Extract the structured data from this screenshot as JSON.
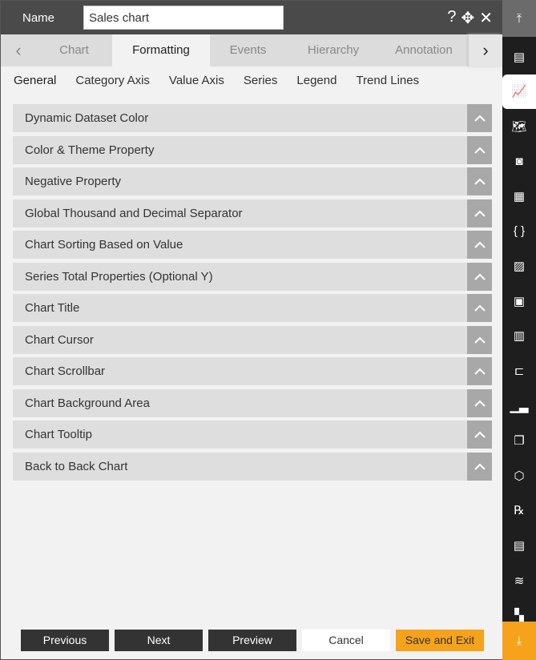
{
  "header": {
    "name_label": "Name",
    "name_value": "Sales chart",
    "help": "?",
    "move": "✥",
    "close": "✕"
  },
  "tabs": [
    "Chart",
    "Formatting",
    "Events",
    "Hierarchy",
    "Annotation"
  ],
  "active_tab": "Formatting",
  "subtabs": [
    "General",
    "Category Axis",
    "Value Axis",
    "Series",
    "Legend",
    "Trend Lines"
  ],
  "sections": [
    "Dynamic Dataset Color",
    "Color & Theme Property",
    "Negative Property",
    "Global Thousand and Decimal Separator",
    "Chart Sorting Based on Value",
    "Series Total Properties (Optional Y)",
    "Chart Title",
    "Chart Cursor",
    "Chart Scrollbar",
    "Chart Background Area",
    "Chart Tooltip",
    "Back to Back Chart"
  ],
  "footer": {
    "previous": "Previous",
    "next": "Next",
    "preview": "Preview",
    "cancel": "Cancel",
    "save": "Save and Exit"
  },
  "sidebar": {
    "icons": [
      "scroll-top-icon",
      "form-icon",
      "chart-icon",
      "map-icon",
      "report-icon",
      "document-icon",
      "code-braces-icon",
      "image-icon",
      "frame-icon",
      "sheet-icon",
      "tree-icon",
      "bar-chart-icon",
      "copy-icon",
      "cubes-icon",
      "rx-icon",
      "file-icon",
      "layers-icon",
      "widgets-icon",
      "scroll-bottom-icon"
    ],
    "active": "chart-icon"
  },
  "colors": {
    "accent": "#f7a21b",
    "header": "#4a4a4a",
    "sidebar": "#1e1e1e"
  }
}
